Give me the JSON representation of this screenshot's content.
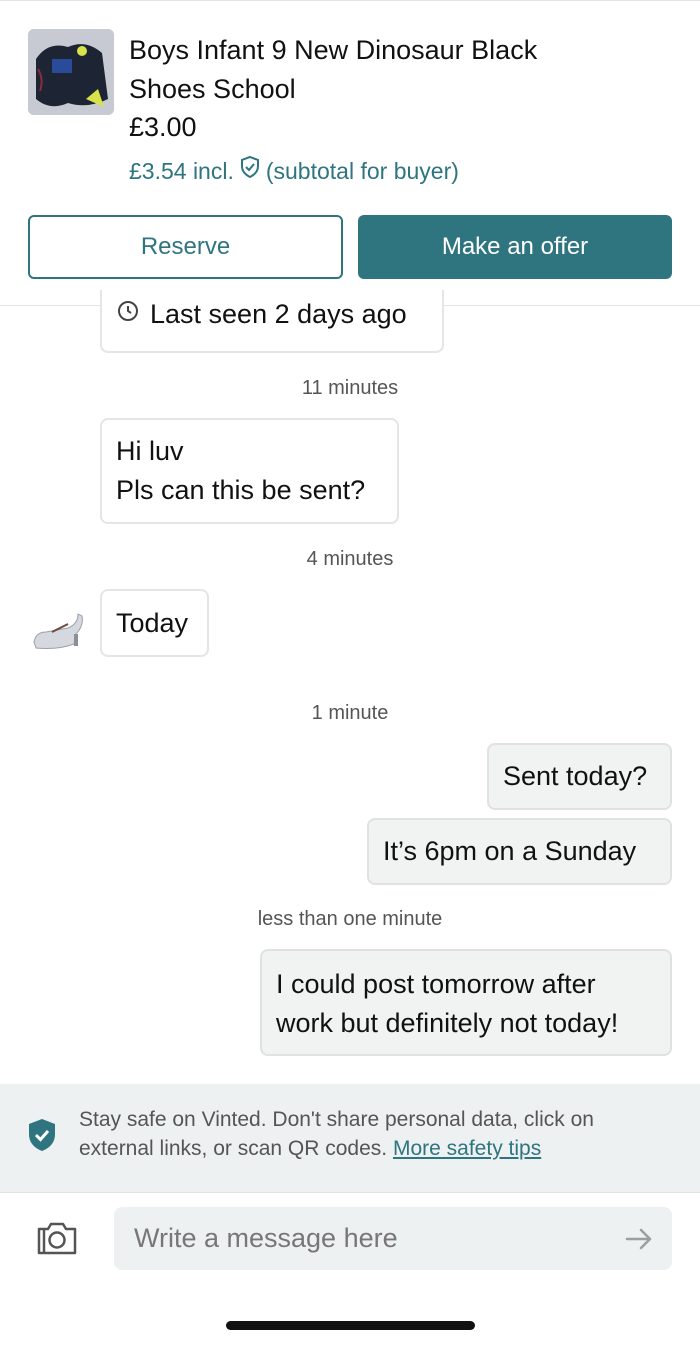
{
  "item": {
    "title_line1": "Boys Infant 9 New Dinosaur Black",
    "title_line2": "Shoes School",
    "price": "£3.00",
    "subtotal_prefix": "£3.54 incl.",
    "subtotal_suffix": "(subtotal for buyer)"
  },
  "actions": {
    "reserve_label": "Reserve",
    "offer_label": "Make an offer"
  },
  "conversation": {
    "last_seen": "Last seen 2 days ago",
    "messages": [
      {
        "time": "11 minutes",
        "sender": "other",
        "lines": [
          "Hi luv",
          "Pls can this be sent?"
        ]
      },
      {
        "time": "4 minutes",
        "sender": "other",
        "lines": [
          "Today"
        ]
      },
      {
        "time": "1 minute",
        "sender": "me",
        "lines": [
          "Sent today?"
        ]
      },
      {
        "time": "",
        "sender": "me",
        "lines": [
          "It’s 6pm on a Sunday"
        ]
      },
      {
        "time": "less than one minute",
        "sender": "me",
        "lines": [
          "I could post tomorrow after",
          "work but definitely not today!"
        ]
      }
    ]
  },
  "safety": {
    "text": "Stay safe on Vinted. Don't share personal data, click on external links, or scan QR codes.",
    "link": "More safety tips"
  },
  "composer": {
    "placeholder": "Write a message here"
  },
  "colors": {
    "accent": "#2f7580",
    "bubble_mine": "#f1f2f2",
    "banner_bg": "#eef1f1"
  },
  "icons": [
    "camera-icon",
    "send-arrow-icon",
    "shield-check-icon",
    "clock-icon"
  ]
}
